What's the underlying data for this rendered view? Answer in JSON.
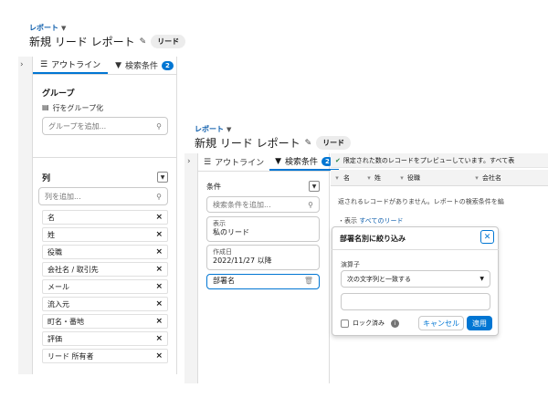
{
  "bg": {
    "crumb": "レポート",
    "title": "新規 リード レポート",
    "badge": "リード",
    "tabs": [
      {
        "label": "アウトライン"
      },
      {
        "label": "検索条件",
        "count": "2"
      }
    ],
    "group_header": "グループ",
    "group_rows_label": "行をグループ化",
    "group_placeholder": "グループを追加...",
    "columns_header": "列",
    "columns_placeholder": "列を追加...",
    "columns": [
      "名",
      "姓",
      "役職",
      "会社名 / 取引先",
      "メール",
      "流入元",
      "町名・番地",
      "評価",
      "リード 所有者"
    ]
  },
  "fg": {
    "crumb": "レポート",
    "title": "新規 リード レポート",
    "badge": "リード",
    "tabs": [
      {
        "label": "アウトライン"
      },
      {
        "label": "検索条件",
        "count": "2"
      }
    ],
    "conditions_header": "条件",
    "filter_placeholder": "検索条件を追加...",
    "filters": [
      {
        "label": "表示",
        "value": "私のリード"
      },
      {
        "label": "作成日",
        "value": "2022/11/27 以降"
      }
    ],
    "new_filter": "部署名",
    "preview_notice": "限定された数のレコードをプレビューしています。すべて表",
    "table_headers": [
      "名",
      "姓",
      "役職",
      "会社名"
    ],
    "no_records": "返されるレコードがありません。レポートの検索条件を編",
    "show_prefix": "・表示",
    "show_link": "すべてのリード",
    "popover": {
      "title": "部署名別に絞り込み",
      "operator_label": "演算子",
      "operator_value": "次の文字列と一致する",
      "value_input": "",
      "lock_label": "ロック済み",
      "cancel": "キャンセル",
      "apply": "適用"
    }
  }
}
